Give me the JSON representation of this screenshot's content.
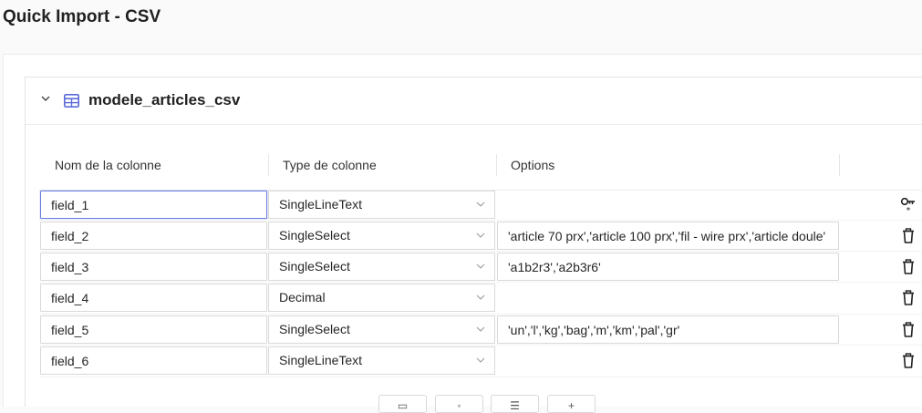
{
  "page": {
    "title": "Quick Import - CSV"
  },
  "table": {
    "name": "modele_articles_csv",
    "columns_header": {
      "name": "Nom de la colonne",
      "type": "Type de colonne",
      "options": "Options"
    },
    "rows": [
      {
        "name": "field_1",
        "type": "SingleLineText",
        "options": null,
        "action": "key-icon",
        "focused": true
      },
      {
        "name": "field_2",
        "type": "SingleSelect",
        "options": "'article 70 prx','article 100 prx','fil - wire prx','article doule'",
        "action": "delete-icon"
      },
      {
        "name": "field_3",
        "type": "SingleSelect",
        "options": "'a1b2r3','a2b3r6'",
        "action": "delete-icon"
      },
      {
        "name": "field_4",
        "type": "Decimal",
        "options": null,
        "action": "delete-icon"
      },
      {
        "name": "field_5",
        "type": "SingleSelect",
        "options": "'un','l','kg','bag','m','km','pal','gr'",
        "action": "delete-icon"
      },
      {
        "name": "field_6",
        "type": "SingleLineText",
        "options": null,
        "action": "delete-icon"
      }
    ]
  },
  "colors": {
    "accent": "#5b6bd8",
    "focus_border": "#6b7fe0",
    "border": "#d9d9d9"
  }
}
